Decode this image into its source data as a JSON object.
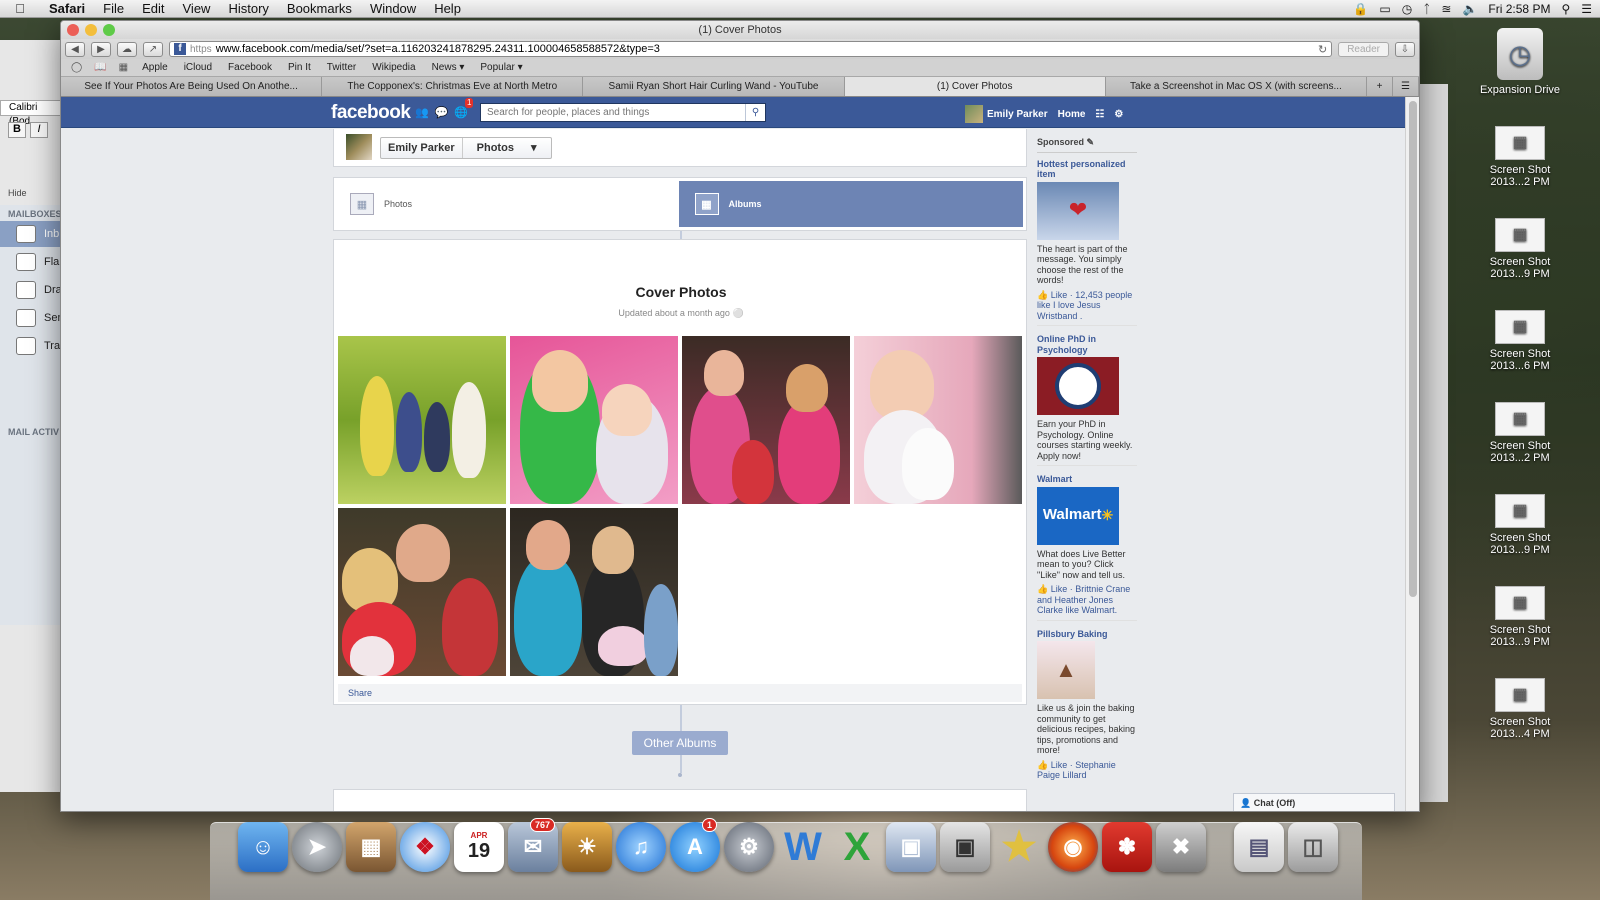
{
  "menubar": {
    "apple": "",
    "items": [
      "Safari",
      "File",
      "Edit",
      "View",
      "History",
      "Bookmarks",
      "Window",
      "Help"
    ],
    "clock": "Fri 2:58 PM"
  },
  "mail": {
    "font": "Calibri (Bod",
    "hide": "Hide",
    "mailboxes": "MAILBOXES",
    "mail_activity": "MAIL ACTIV",
    "items": [
      "Inb",
      "Fla",
      "Dra",
      "Sen",
      "Tra"
    ]
  },
  "desktop": {
    "drive": "Expansion Drive",
    "screenshots": [
      "Screen Shot 2013...2 PM",
      "Screen Shot 2013...9 PM",
      "Screen Shot 2013...6 PM",
      "Screen Shot 2013...2 PM",
      "Screen Shot 2013...9 PM",
      "Screen Shot 2013...9 PM",
      "Screen Shot 2013...4 PM"
    ]
  },
  "safari": {
    "window_title": "(1) Cover Photos",
    "url_scheme": "https",
    "url": "www.facebook.com/media/set/?set=a.116203241878295.24311.100004658588572&type=3",
    "reader": "Reader",
    "bookmarks": [
      "Apple",
      "iCloud",
      "Facebook",
      "Pin It",
      "Twitter",
      "Wikipedia",
      "News ▾",
      "Popular ▾"
    ],
    "tabs": [
      "See If Your Photos Are Being Used On Anothe...",
      "The Copponex's: Christmas Eve at North Metro",
      "Samii Ryan Short Hair Curling Wand - YouTube",
      "(1) Cover Photos",
      "Take a Screenshot in Mac OS X (with screens..."
    ],
    "active_tab": 3
  },
  "facebook": {
    "logo": "facebook",
    "notification_count": "1",
    "search_placeholder": "Search for people, places and things",
    "user_name": "Emily Parker",
    "home": "Home",
    "crumb_name": "Emily Parker",
    "crumb_section": "Photos",
    "toggle_photos": "Photos",
    "toggle_albums": "Albums",
    "album_title": "Cover Photos",
    "album_updated": "Updated about a month ago",
    "share": "Share",
    "other_albums": "Other Albums",
    "chat": "Chat (Off)"
  },
  "ads": {
    "header": "Sponsored",
    "items": [
      {
        "title": "Hottest personalized item",
        "text": "The heart is part of the message. You simply choose the rest of the words!",
        "like": "Like · 12,453 people like I love Jesus Wristband .",
        "image": "heart-wristband"
      },
      {
        "title": "Online PhD in Psychology",
        "text": "Earn your PhD in Psychology. Online courses starting weekly. Apply now!",
        "like": "",
        "image": "university-seal"
      },
      {
        "title": "Walmart",
        "text": "What does Live Better mean to you? Click \"Like\" now and tell us.",
        "like": "Like · Brittnie Crane and Heather Jones Clarke like Walmart.",
        "image": "walmart-logo",
        "image_text": "Walmart"
      },
      {
        "title": "Pillsbury Baking",
        "text": "Like us & join the baking community to get delicious recipes, baking tips, promotions and more!",
        "like": "Like · Stephanie Paige Lillard",
        "image": "cupcakes"
      }
    ]
  },
  "dock": {
    "mail_badge": "767",
    "appstore_badge": "1",
    "calendar_month": "APR",
    "calendar_day": "19"
  },
  "colors": {
    "fb_blue": "#3b5998",
    "fb_active": "#6d84b4",
    "badge_red": "#d92a24"
  }
}
